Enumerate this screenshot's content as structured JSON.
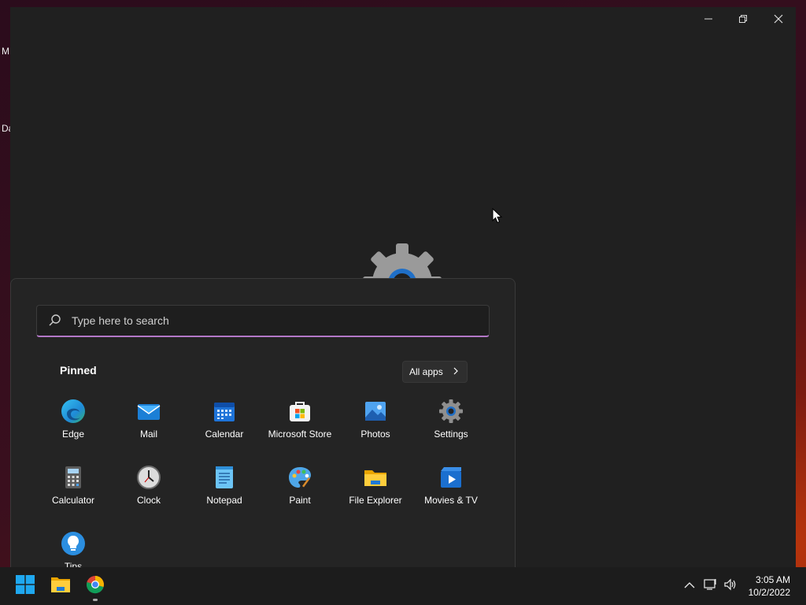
{
  "desktop": {
    "label_1": "M",
    "label_2": "Da"
  },
  "window": {
    "minimize_icon": "minimize-icon",
    "restore_icon": "restore-icon",
    "close_icon": "close-icon"
  },
  "start_menu": {
    "search_placeholder": "Type here to search",
    "pinned_label": "Pinned",
    "all_apps_label": "All apps",
    "pinned_apps": [
      {
        "label": "Edge",
        "icon": "edge-icon"
      },
      {
        "label": "Mail",
        "icon": "mail-icon"
      },
      {
        "label": "Calendar",
        "icon": "calendar-icon"
      },
      {
        "label": "Microsoft Store",
        "icon": "store-icon"
      },
      {
        "label": "Photos",
        "icon": "photos-icon"
      },
      {
        "label": "Settings",
        "icon": "settings-icon"
      },
      {
        "label": "Calculator",
        "icon": "calculator-icon"
      },
      {
        "label": "Clock",
        "icon": "clock-icon"
      },
      {
        "label": "Notepad",
        "icon": "notepad-icon"
      },
      {
        "label": "Paint",
        "icon": "paint-icon"
      },
      {
        "label": "File Explorer",
        "icon": "folder-icon"
      },
      {
        "label": "Movies & TV",
        "icon": "movies-icon"
      },
      {
        "label": "Tips",
        "icon": "tips-icon"
      }
    ]
  },
  "taskbar": {
    "items": [
      {
        "name": "start-button",
        "icon": "windows-logo-icon"
      },
      {
        "name": "file-explorer-taskbar-button",
        "icon": "folder-icon"
      },
      {
        "name": "chrome-taskbar-button",
        "icon": "chrome-icon"
      }
    ],
    "time": "3:05 AM",
    "date": "10/2/2022"
  },
  "colors": {
    "accent_underline": "#b478c8",
    "window_bg": "#202020",
    "start_bg": "#242424",
    "taskbar_bg": "#1c1c1c"
  }
}
